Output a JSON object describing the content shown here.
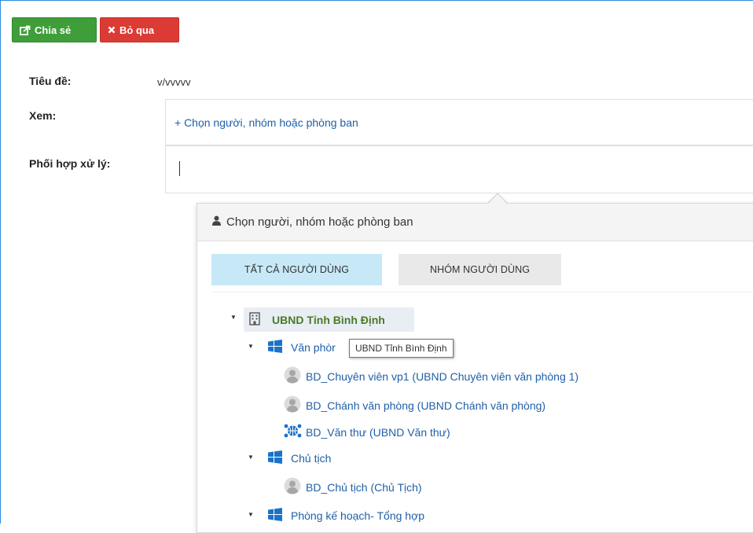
{
  "toolbar": {
    "share_label": "Chia sẻ",
    "skip_label": "Bỏ qua"
  },
  "form": {
    "title_label": "Tiêu đề:",
    "title_value": "v/vvvvv",
    "view_label": "Xem:",
    "view_placeholder": "+ Chọn người, nhóm hoặc phòng ban",
    "coordinate_label": "Phối hợp xử lý:",
    "coordinate_value": ""
  },
  "picker": {
    "header": "Chọn người, nhóm hoặc phòng ban",
    "tabs": [
      {
        "label": "TẤT CẢ NGƯỜI DÙNG",
        "active": true
      },
      {
        "label": "NHÓM NGƯỜI DÙNG",
        "active": false
      }
    ],
    "tree": {
      "root": "UBND Tỉnh Bình Định",
      "groups": [
        {
          "name": "Văn phòng",
          "name_visible": "Văn phòr",
          "members": [
            {
              "label": "BD_Chuyên viên vp1 (UBND Chuyên viên văn phòng 1)",
              "icon": "user-icon"
            },
            {
              "label": "BD_Chánh văn phòng (UBND Chánh văn phòng)",
              "icon": "user-icon"
            },
            {
              "label": "BD_Văn thư (UBND Văn thư)",
              "icon": "network-icon"
            }
          ]
        },
        {
          "name": "Chủ tịch",
          "members": [
            {
              "label": "BD_Chủ tịch (Chủ Tịch)",
              "icon": "user-icon"
            }
          ]
        },
        {
          "name": "Phòng kế hoạch- Tổng hợp",
          "members": []
        }
      ]
    },
    "tooltip": "UBND Tỉnh Bình Định"
  },
  "colors": {
    "share_button": "#3f9e3a",
    "skip_button": "#dc3b35",
    "link": "#1f5fa8",
    "active_tab": "#c7e8f7",
    "root_label": "#4a7a2a",
    "frame_border": "#2a8be0"
  }
}
